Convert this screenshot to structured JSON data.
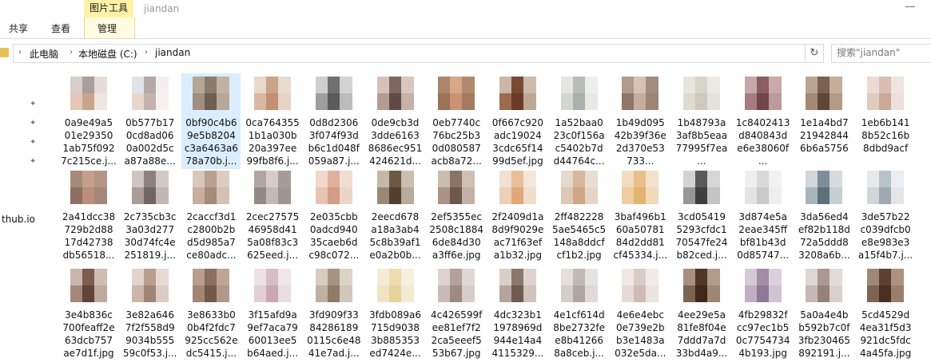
{
  "ribbon": {
    "context_tab": "图片工具",
    "window_title": "jiandan",
    "tabs": [
      "共享",
      "查看",
      "管理"
    ]
  },
  "address": {
    "crumbs": [
      "此电脑",
      "本地磁盘 (C:)",
      "jiandan"
    ],
    "search_placeholder": "搜索\"jiandan\""
  },
  "nav": {
    "truncated_item": "thub.io"
  },
  "colors": {
    "selection": "#dbeeff",
    "context_tab": "#fff2a8",
    "pin": "#6a7aa0"
  },
  "files": [
    {
      "lines": [
        "0a9e49a5",
        "01e29350",
        "1ab75f092",
        "7c215ce.j..."
      ],
      "colors": [
        "#d9cfc9",
        "#a89e9c",
        "#e7ddd6",
        "#e4c7b4",
        "#c9a58d",
        "#f0e6e0"
      ]
    },
    {
      "lines": [
        "0b577b17",
        "0cd8ad06",
        "0a002d5c",
        "a87a88e..."
      ],
      "colors": [
        "#e0e4ea",
        "#b3a9a9",
        "#f2efee",
        "#e8d7cd",
        "#c6b2ab",
        "#f5f1ee"
      ]
    },
    {
      "lines": [
        "0bf90c4b6",
        "9e5b8204",
        "c3a6463a6",
        "78a70b.j..."
      ],
      "colors": [
        "#b5a696",
        "#8b7b6d",
        "#c2b0a0",
        "#a08f81",
        "#6f5f52",
        "#b9a79a"
      ]
    },
    {
      "lines": [
        "0ca764355",
        "1b1a030b",
        "20a397ee",
        "99fb8f6.j..."
      ],
      "colors": [
        "#e8d8cc",
        "#c9a48a",
        "#e9dbd0",
        "#d9b8a3",
        "#c48f72",
        "#e7d3c6"
      ]
    },
    {
      "lines": [
        "0d8d2306",
        "3f074f93d",
        "b6c1d048f",
        "059a87.j..."
      ],
      "colors": [
        "#cfcfcf",
        "#707070",
        "#d3d3d3",
        "#9e9e9e",
        "#5b5b5b",
        "#bcbcbc"
      ]
    },
    {
      "lines": [
        "0de9cb3d",
        "3dde6163",
        "8686ec951",
        "424621d..."
      ],
      "colors": [
        "#d6c1b8",
        "#7e655e",
        "#d9c6bd",
        "#b59b92",
        "#5f4a45",
        "#c8b1a7"
      ]
    },
    {
      "lines": [
        "0eb7740c",
        "76bc25b3",
        "0d080587",
        "acb8a72..."
      ],
      "colors": [
        "#a9866b",
        "#d8a789",
        "#b08a6e",
        "#9a7258",
        "#c99374",
        "#a27b61"
      ]
    },
    {
      "lines": [
        "0f667c920",
        "adc19024",
        "3cdc65f14",
        "99d5ef.jpg"
      ],
      "colors": [
        "#c8b7aa",
        "#7b4a33",
        "#cbbcaf",
        "#9c6a4f",
        "#6b3b26",
        "#bfa796"
      ]
    },
    {
      "lines": [
        "1a52baa0",
        "23c0f156a",
        "c5402b7d",
        "d44764c..."
      ],
      "colors": [
        "#e5e5e2",
        "#b8bcb8",
        "#eeeeec",
        "#d4d6d2",
        "#aab0ab",
        "#e8e8e5"
      ]
    },
    {
      "lines": [
        "1b49d095",
        "42b39f36e",
        "2d370e53",
        "733..."
      ],
      "colors": [
        "#b29a8c",
        "#d7c2b6",
        "#a38c80",
        "#8e766a",
        "#c8ac9d",
        "#9c8477"
      ]
    },
    {
      "lines": [
        "1b48793a",
        "3af8b5eaa",
        "77995f7ea",
        "..."
      ],
      "colors": [
        "#e7e5de",
        "#d7d4c8",
        "#ebe9e2",
        "#dedbd0",
        "#cdc9bb",
        "#e5e2d9"
      ]
    },
    {
      "lines": [
        "1c8402413",
        "d840843d",
        "e6e38060f",
        "..."
      ],
      "colors": [
        "#c5a9a9",
        "#8b5f62",
        "#caa9a8",
        "#a87c7d",
        "#6f4649",
        "#bd9a9a"
      ]
    },
    {
      "lines": [
        "1e1a4bd7",
        "21942844",
        "6b6a5756",
        ""
      ],
      "colors": [
        "#b9a597",
        "#7a6251",
        "#c6ae9c",
        "#a48873",
        "#5e4738",
        "#b39a87"
      ]
    },
    {
      "lines": [
        "1eb6b141",
        "8b52c16b",
        "8dbd9acf",
        ""
      ],
      "colors": [
        "#eadcd4",
        "#d8bfb1",
        "#efe4de",
        "#e0cbbf",
        "#caa997",
        "#ece0d9"
      ]
    },
    {
      "lines": [
        "2a41dcc38",
        "729b2d88",
        "17d42738",
        "db56518..."
      ],
      "colors": [
        "#a8897a",
        "#c59f8c",
        "#b59586",
        "#8e6f63",
        "#b98e7c",
        "#a4867a"
      ]
    },
    {
      "lines": [
        "2c735cb3c",
        "3a03d277",
        "30d74fc4e",
        "251819.j..."
      ],
      "colors": [
        "#cfc6c0",
        "#8d817b",
        "#d2c9c3",
        "#a99d96",
        "#716760",
        "#c2b8b1"
      ]
    },
    {
      "lines": [
        "2caccf3d1",
        "c2800b2b",
        "d5d985a7",
        "ce80adc..."
      ],
      "colors": [
        "#d9c7bb",
        "#bba08f",
        "#dccbbf",
        "#c7ae9f",
        "#a58b7b",
        "#d4c0b4"
      ]
    },
    {
      "lines": [
        "2cec27575",
        "46958d41",
        "5a08f83c3",
        "625eed.j..."
      ],
      "colors": [
        "#b1a6a1",
        "#d6cdc8",
        "#a69b96",
        "#948984",
        "#c4bab5",
        "#9f948f"
      ]
    },
    {
      "lines": [
        "2e035cbb",
        "0adcd940",
        "35caeb6d",
        "c98c072..."
      ],
      "colors": [
        "#f0d8cc",
        "#dfb09c",
        "#f2ddd2",
        "#e8c3b1",
        "#d39d86",
        "#eed5c9"
      ]
    },
    {
      "lines": [
        "2eecd678",
        "a18a3ab4",
        "5c8b39af1",
        "e0a2b0b..."
      ],
      "colors": [
        "#c3b8ab",
        "#6c5944",
        "#c9beb1",
        "#998874",
        "#523f2d",
        "#b8ab9c"
      ]
    },
    {
      "lines": [
        "2ef5355ec",
        "2508c1884",
        "6de84d30",
        "a3ff6e.jpg"
      ],
      "colors": [
        "#cbbcb1",
        "#8a7466",
        "#cfc0b5",
        "#aa9384",
        "#6d594c",
        "#c2b1a4"
      ]
    },
    {
      "lines": [
        "2f2409d1a",
        "8d9f9029e",
        "ac71f63ef",
        "a1b32.jpg"
      ],
      "colors": [
        "#f1e1d4",
        "#e8bf9a",
        "#f3e6da",
        "#edd0b5",
        "#dfa97c",
        "#f0ddcc"
      ]
    },
    {
      "lines": [
        "2ff482228",
        "5ae5465c5",
        "148a8ddcf",
        "cf1b2.jpg"
      ],
      "colors": [
        "#e5d9cd",
        "#d8b79b",
        "#e9ded3",
        "#dfc8b3",
        "#cfa785",
        "#e4d5c8"
      ]
    },
    {
      "lines": [
        "3baf496b1",
        "60a50781",
        "84d2dd81",
        "cf45334.j..."
      ],
      "colors": [
        "#f2dcc2",
        "#e8c08a",
        "#f4e1cb",
        "#f0cd9e",
        "#e2b46f",
        "#f1d9bb"
      ]
    },
    {
      "lines": [
        "3cd05419",
        "5293cfdc1",
        "70547fe24",
        "b82ced.j..."
      ],
      "colors": [
        "#d2d2d2",
        "#595959",
        "#d6d6d6",
        "#979797",
        "#3f3f3f",
        "#c4c4c4"
      ]
    },
    {
      "lines": [
        "3d874e5a",
        "2eae345ff",
        "bf81b43d",
        "0d85747..."
      ],
      "colors": [
        "#efefef",
        "#d9d9d9",
        "#f2f2f2",
        "#e3e3e3",
        "#c9c9c9",
        "#eeeeee"
      ]
    },
    {
      "lines": [
        "3da56ed4",
        "ef82b118d",
        "72a5ddd8",
        "3208a6b..."
      ],
      "colors": [
        "#d0d6da",
        "#7d8e99",
        "#d5dbdf",
        "#a7b5be",
        "#5d6f7b",
        "#c5ced3"
      ]
    },
    {
      "lines": [
        "3de57b22",
        "c039dfcb0",
        "e8e983e3",
        "a15f4b7.j..."
      ],
      "colors": [
        "#e7eaec",
        "#b9c2c8",
        "#ebeef0",
        "#d0d7db",
        "#9ea9b1",
        "#e2e6e9"
      ]
    },
    {
      "lines": [
        "3e4b836c",
        "700feaff2e",
        "63dcb757",
        "ae7d1f.jpg"
      ],
      "colors": [
        "#c9b6ad",
        "#7e5c4e",
        "#cfbdb4",
        "#a5877a",
        "#614437",
        "#bfa99f"
      ]
    },
    {
      "lines": [
        "3e82a646",
        "7f2f558d9",
        "9034b555",
        "59c0f53.j..."
      ],
      "colors": [
        "#e2d3cb",
        "#b89d90",
        "#e6d9d2",
        "#cdb5aa",
        "#9f8376",
        "#ddccc3"
      ]
    },
    {
      "lines": [
        "3e8633b0",
        "0b4f2fdc7",
        "925cc562e",
        "dc5415.j..."
      ],
      "colors": [
        "#b79e8f",
        "#8a6e5e",
        "#bda597",
        "#a18576",
        "#735748",
        "#b2988a"
      ]
    },
    {
      "lines": [
        "3f15afd9a",
        "9ef7aca79",
        "60013ee5",
        "b64aed.j..."
      ],
      "colors": [
        "#ece1e5",
        "#d7bdc6",
        "#efe6e9",
        "#e2cfd5",
        "#c9a8b3",
        "#eadde2"
      ]
    },
    {
      "lines": [
        "3fd909f33",
        "84286189",
        "0115c6e48",
        "41e7ad.j..."
      ],
      "colors": [
        "#d7cdc2",
        "#a69483",
        "#dbd2c8",
        "#c0b0a1",
        "#8f7b68",
        "#d1c6ba"
      ]
    },
    {
      "lines": [
        "3fdb089a6",
        "715d9038",
        "3b885353",
        "ed7424e..."
      ],
      "colors": [
        "#f4ecd6",
        "#ecdcb0",
        "#f6efdd",
        "#f0e4c3",
        "#e6d29b",
        "#f3ead2"
      ]
    },
    {
      "lines": [
        "4c426599f",
        "ee81ef7f2",
        "2ca5eeef5",
        "53b67.jpg"
      ],
      "colors": [
        "#ddd2cd",
        "#b3a19a",
        "#e1d7d2",
        "#c9bab3",
        "#9d8a82",
        "#d8ccc6"
      ]
    },
    {
      "lines": [
        "4dc323b1",
        "1978969d",
        "944e14a4",
        "4115329..."
      ],
      "colors": [
        "#d9cec8",
        "#8d786e",
        "#ddd3cd",
        "#b4a49b",
        "#6f5b51",
        "#cfc3bc"
      ]
    },
    {
      "lines": [
        "4e1cf614d",
        "8be2732fe",
        "e8b41266",
        "8a8ceb.j..."
      ],
      "colors": [
        "#e3dfdd",
        "#c2b9b5",
        "#e7e3e1",
        "#d4cdca",
        "#b0a6a1",
        "#dfdad8"
      ]
    },
    {
      "lines": [
        "4e6e4ebc",
        "0e739e2b",
        "b3e1483a",
        "032e5da..."
      ],
      "colors": [
        "#eee7e4",
        "#dacbc5",
        "#f1ebe8",
        "#e5dad5",
        "#cfbbb4",
        "#ebe3df"
      ]
    },
    {
      "lines": [
        "4ee29e5a",
        "81fe8f04e",
        "7ddd7a7d",
        "33bd4a9..."
      ],
      "colors": [
        "#a8907f",
        "#4f3627",
        "#b09a8a",
        "#7c6352",
        "#3e281c",
        "#9f8573"
      ]
    },
    {
      "lines": [
        "4fb29832f",
        "cc97ec1b5",
        "0c7754734",
        "4b193.jpg"
      ],
      "colors": [
        "#d6c9d6",
        "#a28ea6",
        "#dbcfdb",
        "#c0aec3",
        "#8f7994",
        "#d1c3d2"
      ]
    },
    {
      "lines": [
        "5a0a4e4b",
        "b592b7c0f",
        "3fb230465",
        "892191.j..."
      ],
      "colors": [
        "#dfd6d1",
        "#ab9891",
        "#e3dbd6",
        "#c7b8b2",
        "#97827a",
        "#dad0ca"
      ]
    },
    {
      "lines": [
        "5cd4529d",
        "4ea31f5d3",
        "921dc5fdc",
        "4a45fa.jpg"
      ],
      "colors": [
        "#a28776",
        "#5c4030",
        "#ab9281",
        "#7f6453",
        "#4a3022",
        "#9a7e6c"
      ]
    }
  ]
}
